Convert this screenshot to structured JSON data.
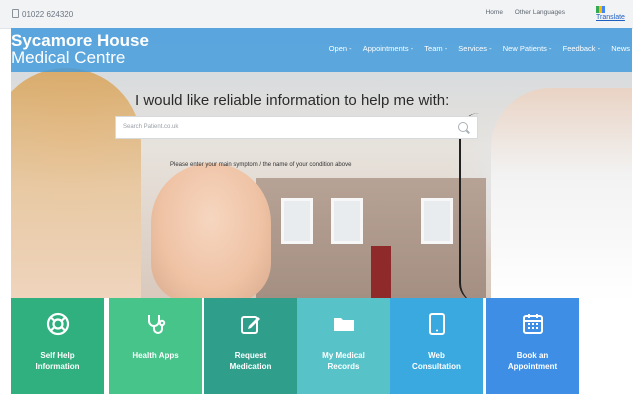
{
  "topbar": {
    "phone": "01022 624320",
    "links": [
      "Home",
      "Other Languages"
    ],
    "translate": "Translate"
  },
  "brand": {
    "line1": "Sycamore House",
    "line2": "Medical Centre"
  },
  "nav": [
    "Open -",
    "Appointments -",
    "Team -",
    "Services -",
    "New Patients -",
    "Feedback -",
    "News"
  ],
  "hero": {
    "headline": "I would like reliable information to help me with:",
    "search_placeholder": "Search Patient.co.uk",
    "hint": "Please enter your main symptom / the name of your condition above"
  },
  "tiles": [
    {
      "line1": "Self Help",
      "line2": "Information",
      "icon": "lifebuoy-icon",
      "color": "#2fb07e"
    },
    {
      "line1": "Health Apps",
      "line2": "",
      "icon": "stethoscope-icon",
      "color": "#46c489"
    },
    {
      "line1": "Request",
      "line2": "Medication",
      "icon": "edit-icon",
      "color": "#2f9f8c"
    },
    {
      "line1": "My Medical",
      "line2": "Records",
      "icon": "folder-icon",
      "color": "#57c3c8"
    },
    {
      "line1": "Web",
      "line2": "Consultation",
      "icon": "tablet-icon",
      "color": "#3aa9df"
    },
    {
      "line1": "Book an",
      "line2": "Appointment",
      "icon": "calendar-icon",
      "color": "#3e8ee6"
    }
  ],
  "colors": {
    "navbar": "#3f9add",
    "topbar": "#f2f3f5"
  }
}
